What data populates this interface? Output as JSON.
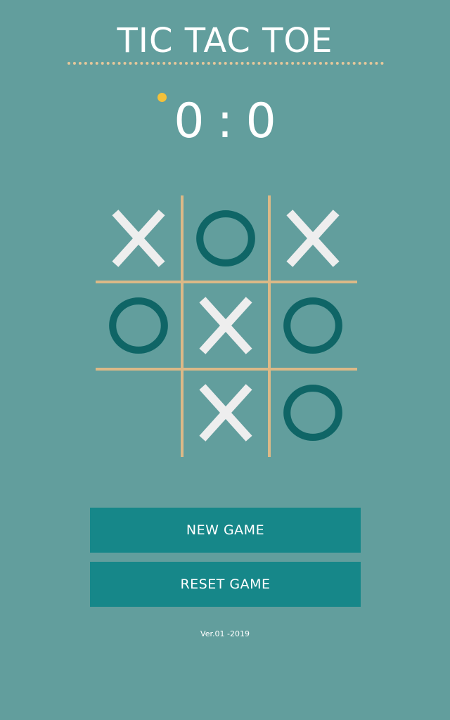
{
  "title": "TIC TAC TOE",
  "score": {
    "left": "0",
    "separator": ":",
    "right": "0"
  },
  "board": {
    "cells": [
      "X",
      "O",
      "X",
      "O",
      "X",
      "O",
      "",
      "X",
      "O"
    ]
  },
  "buttons": {
    "new_game": "NEW GAME",
    "reset_game": "RESET GAME"
  },
  "version": "Ver.01 -2019",
  "colors": {
    "background": "#629e9d",
    "x_mark": "#eeeeee",
    "o_mark": "#0f6566",
    "grid": "#dcb987",
    "turn_indicator": "#f3c13a",
    "button": "#168789"
  }
}
